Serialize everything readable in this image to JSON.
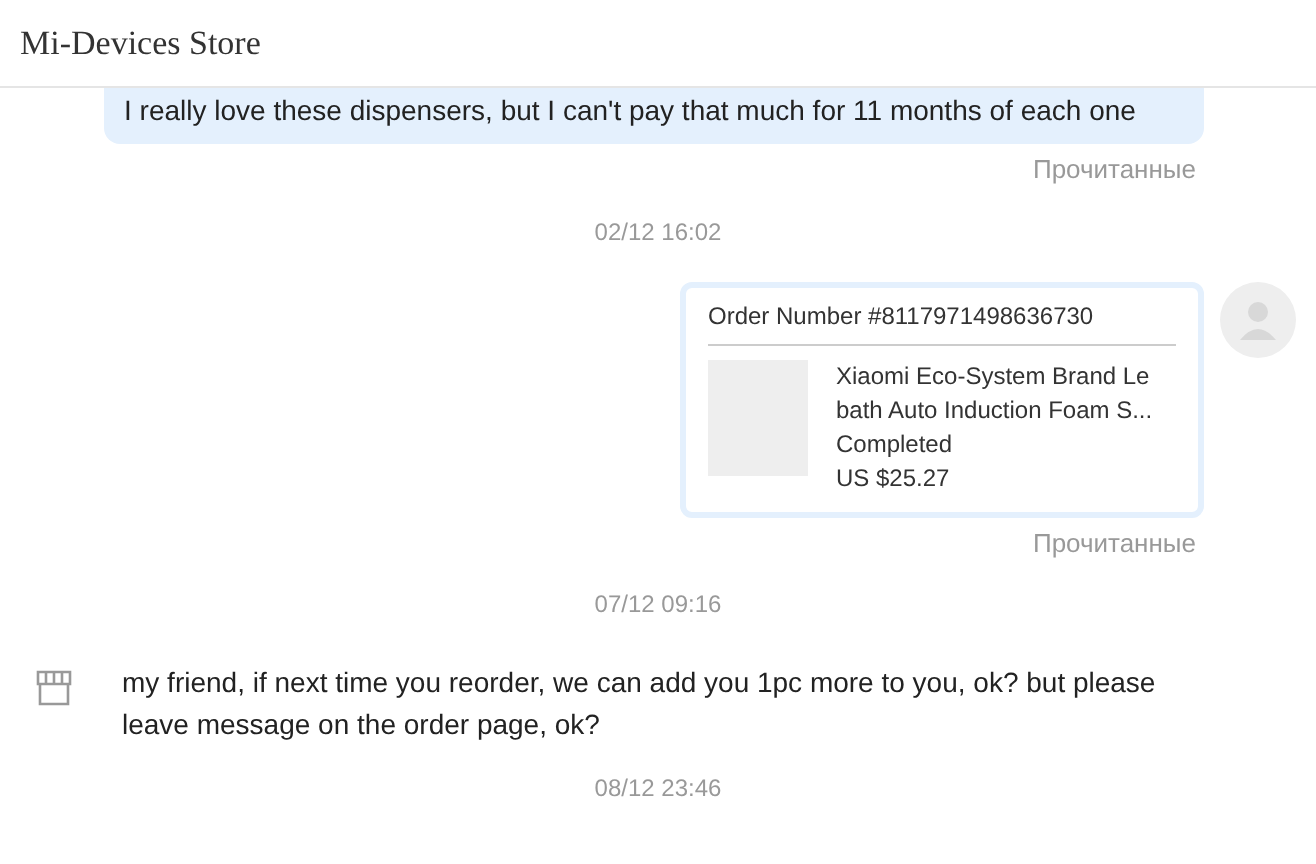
{
  "header": {
    "title": "Mi-Devices Store"
  },
  "messages": [
    {
      "kind": "outgoing_text",
      "text": "I really love these dispensers, but I can't pay that much for 11 months of each one",
      "status": "Прочитанные"
    },
    {
      "kind": "timestamp",
      "text": "02/12 16:02"
    },
    {
      "kind": "order_card",
      "order_number": "Order Number #8117971498636730",
      "product": "Xiaomi Eco-System Brand Le bath Auto Induction Foam S...",
      "order_status": "Completed",
      "price": "US $25.27",
      "status": "Прочитанные"
    },
    {
      "kind": "timestamp",
      "text": "07/12 09:16"
    },
    {
      "kind": "incoming_text",
      "text": "my friend, if next time you reorder, we can add you 1pc more to you, ok? but please leave message on the order page, ok?"
    },
    {
      "kind": "timestamp",
      "text": "08/12 23:46"
    }
  ]
}
